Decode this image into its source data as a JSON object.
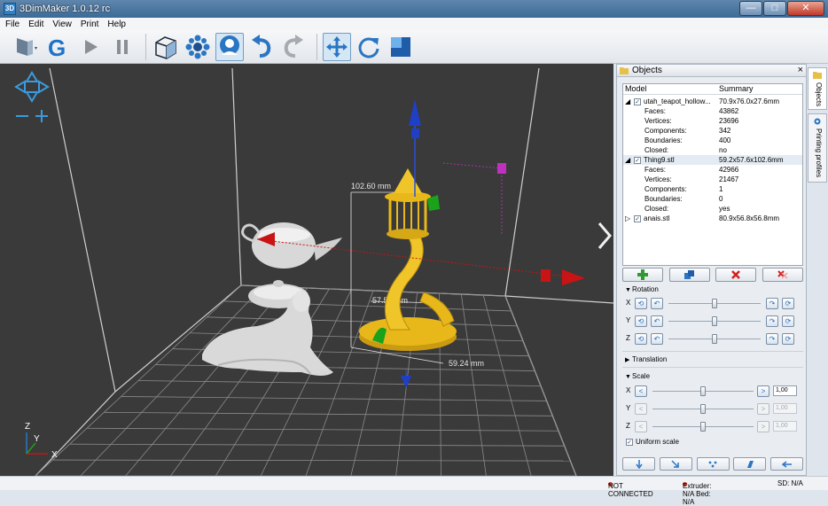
{
  "window": {
    "title": "3DimMaker 1.0.12 rc",
    "app_icon_text": "3D"
  },
  "menu": [
    "File",
    "Edit",
    "View",
    "Print",
    "Help"
  ],
  "toolbar": {
    "icons": [
      "load-model-icon",
      "generate-gcode-icon",
      "play-icon",
      "pause-icon",
      "view-cube-icon",
      "support-icon",
      "user-assist-icon",
      "undo-icon",
      "redo-icon",
      "move-icon",
      "rotate-icon",
      "scale-icon"
    ],
    "selected": "move-icon"
  },
  "viewport": {
    "dimensions": {
      "height_label": "102.60 mm",
      "depth_label": "57.58 mm",
      "width_label": "59.24 mm"
    },
    "axes": {
      "z": "Z",
      "y": "Y",
      "x": "X"
    },
    "colors": {
      "background": "#3a3a3a",
      "model_selected": "#e8b81a",
      "model": "#cfcfcf",
      "gizmo_z": "#1f3fc7",
      "gizmo_x": "#c81414",
      "gizmo_y": "#1aa31a",
      "gizmo_scale": "#c030c0"
    }
  },
  "objects_panel": {
    "title": "Objects",
    "columns": {
      "model": "Model",
      "summary": "Summary"
    },
    "models": [
      {
        "name": "utah_teapot_hollow...",
        "summary": "70.9x76.0x27.6mm",
        "expanded": true,
        "checked": true,
        "props": [
          {
            "k": "Faces:",
            "v": "43862"
          },
          {
            "k": "Vertices:",
            "v": "23696"
          },
          {
            "k": "Components:",
            "v": "342"
          },
          {
            "k": "Boundaries:",
            "v": "400"
          },
          {
            "k": "Closed:",
            "v": "no"
          }
        ]
      },
      {
        "name": "Thing9.stl",
        "summary": "59.2x57.6x102.6mm",
        "expanded": true,
        "checked": true,
        "props": [
          {
            "k": "Faces:",
            "v": "42966"
          },
          {
            "k": "Vertices:",
            "v": "21467"
          },
          {
            "k": "Components:",
            "v": "1"
          },
          {
            "k": "Boundaries:",
            "v": "0"
          },
          {
            "k": "Closed:",
            "v": "yes"
          }
        ]
      },
      {
        "name": "anais.stl",
        "summary": "80.9x56.8x56.8mm",
        "expanded": false,
        "checked": true,
        "props": []
      }
    ]
  },
  "rotation": {
    "label": "Rotation",
    "axes": [
      "X",
      "Y",
      "Z"
    ],
    "levels": [
      0.5,
      0.5,
      0.5
    ]
  },
  "translation": {
    "label": "Translation"
  },
  "scale": {
    "label": "Scale",
    "axes": [
      "X",
      "Y",
      "Z"
    ],
    "values": [
      "1,00",
      "1,00",
      "1,00"
    ],
    "levels": [
      0.5,
      0.5,
      0.5
    ],
    "uniform_label": "Uniform scale",
    "uniform_checked": true
  },
  "side_tabs": {
    "objects": "Objects",
    "profiles": "Printing profiles"
  },
  "status": {
    "connection": "NOT CONNECTED",
    "temps": "Extruder: N/A Bed: N/A",
    "sd": "SD: N/A"
  }
}
